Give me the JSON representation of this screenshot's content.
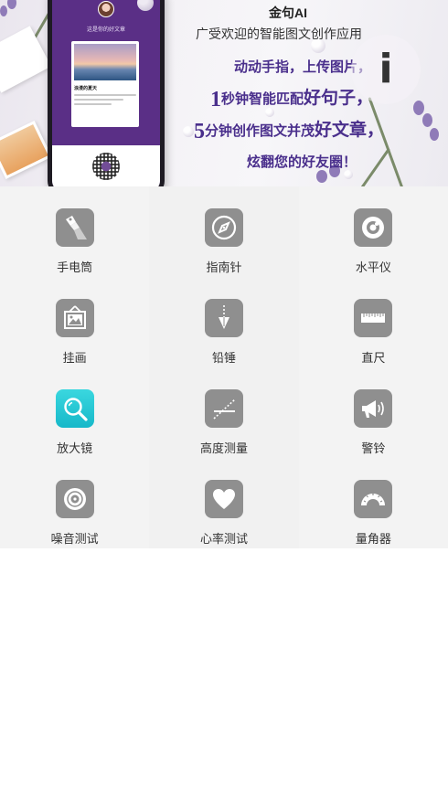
{
  "banner": {
    "title": "金句AI",
    "subtitle": "广受欢迎的智能图文创作应用",
    "line1": "动动手指，上传图片，",
    "line2_num": "1",
    "line2_text": "秒钟智能匹配",
    "line2_accent": "好句子，",
    "line3_num": "5",
    "line3_text": "分钟创作图文并茂",
    "line3_accent": "好文章，",
    "line4": "炫翻您的好友圈！",
    "info_button_glyph": "i",
    "phone": {
      "header": "这是你的好文章",
      "card_title": "浪漫的夏天"
    }
  },
  "tools": [
    {
      "label": "手电筒",
      "icon": "flashlight-icon"
    },
    {
      "label": "指南针",
      "icon": "compass-icon"
    },
    {
      "label": "水平仪",
      "icon": "level-icon"
    },
    {
      "label": "挂画",
      "icon": "picture-hanging-icon"
    },
    {
      "label": "铅锤",
      "icon": "plumb-bob-icon"
    },
    {
      "label": "直尺",
      "icon": "ruler-icon"
    },
    {
      "label": "放大镜",
      "icon": "magnifier-icon"
    },
    {
      "label": "高度测量",
      "icon": "height-measure-icon"
    },
    {
      "label": "警铃",
      "icon": "alarm-megaphone-icon"
    },
    {
      "label": "噪音测试",
      "icon": "noise-test-icon"
    },
    {
      "label": "心率测试",
      "icon": "heart-rate-icon"
    },
    {
      "label": "量角器",
      "icon": "protractor-icon"
    }
  ],
  "colors": {
    "icon_gray": "#8f8f8f",
    "icon_cyan": "#1fc3d0",
    "banner_purple": "#4a2f8c",
    "grid_bg": "#f3f3f3"
  }
}
